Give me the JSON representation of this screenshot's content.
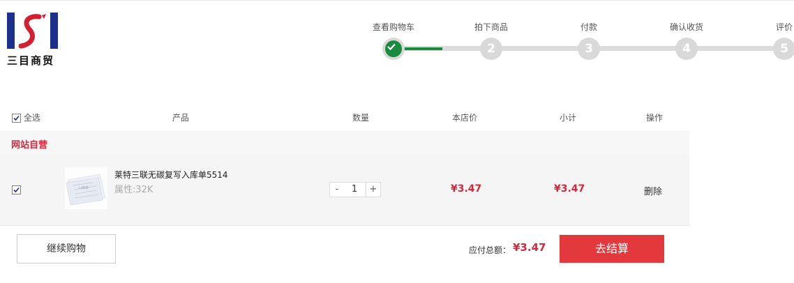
{
  "brand": {
    "logo_text": "三目商贸",
    "colors": {
      "logo_blue": "#1c2f8c",
      "logo_red": "#d22030"
    }
  },
  "steps": [
    {
      "label": "查看购物车",
      "number": "",
      "state": "done"
    },
    {
      "label": "拍下商品",
      "number": "2",
      "state": "pending"
    },
    {
      "label": "付款",
      "number": "3",
      "state": "pending"
    },
    {
      "label": "确认收货",
      "number": "4",
      "state": "pending"
    },
    {
      "label": "评价",
      "number": "5",
      "state": "pending"
    }
  ],
  "table": {
    "select_all": "全选",
    "select_all_checked": true,
    "headers": {
      "product": "产品",
      "quantity": "数量",
      "price": "本店价",
      "subtotal": "小计",
      "actions": "操作"
    }
  },
  "shop": {
    "name": "网站自营"
  },
  "items": [
    {
      "checked": true,
      "name": "莱特三联无碳复写入库单5514",
      "attribute": "属性:32K",
      "quantity": "1",
      "price": "¥3.47",
      "subtotal": "¥3.47",
      "delete_label": "删除",
      "thumbnail_text": "入库单"
    }
  ],
  "footer": {
    "continue_label": "继续购物",
    "total_label": "应付总额：",
    "total_value": "¥3.47",
    "checkout_label": "去结算"
  },
  "colors": {
    "accent_red": "#e4393c",
    "price_red": "#d7273a",
    "step_green": "#1a8b3e"
  }
}
